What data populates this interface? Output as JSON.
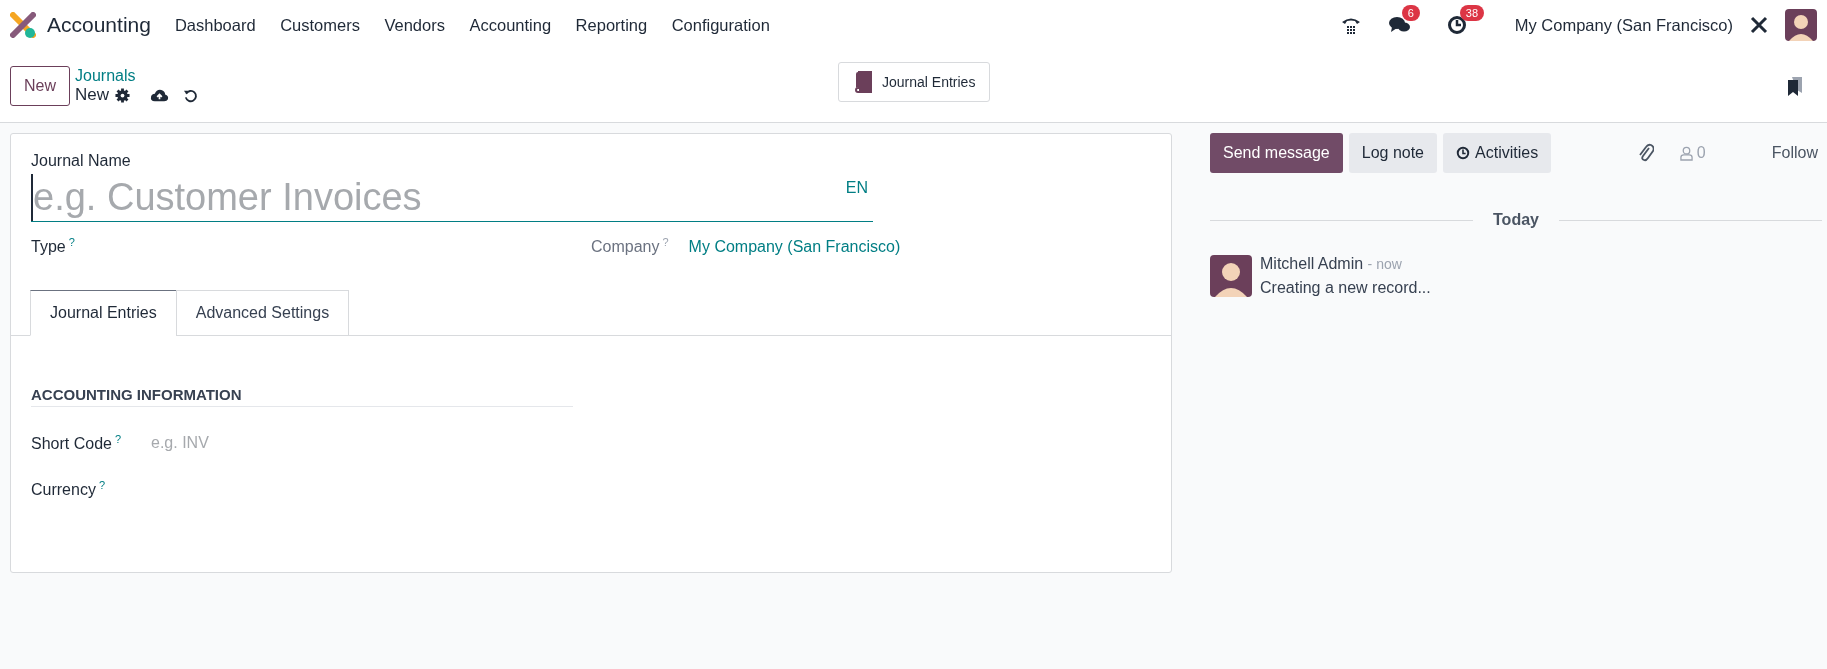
{
  "navbar": {
    "app_name": "Accounting",
    "menu": [
      "Dashboard",
      "Customers",
      "Vendors",
      "Accounting",
      "Reporting",
      "Configuration"
    ],
    "messages_count": "6",
    "activities_count": "38",
    "company": "My Company (San Francisco)"
  },
  "control_panel": {
    "new_button": "New",
    "breadcrumb": "Journals",
    "record_name": "New",
    "smart_button": "Journal Entries"
  },
  "form": {
    "journal_name": {
      "label": "Journal Name",
      "placeholder": "e.g. Customer Invoices",
      "lang": "EN"
    },
    "type": {
      "label": "Type",
      "help": "?"
    },
    "company": {
      "label": "Company",
      "help": "?",
      "value": "My Company (San Francisco)"
    },
    "tabs": [
      {
        "label": "Journal Entries",
        "selected": true
      },
      {
        "label": "Advanced Settings",
        "selected": false
      }
    ],
    "section_title": "ACCOUNTING INFORMATION",
    "fields": [
      {
        "label": "Short Code",
        "help": "?",
        "placeholder": "e.g. INV"
      },
      {
        "label": "Currency",
        "help": "?"
      }
    ]
  },
  "chatter": {
    "buttons": [
      {
        "label": "Send message",
        "kind": "primary"
      },
      {
        "label": "Log note",
        "kind": "plain"
      },
      {
        "label": "Activities",
        "kind": "clock"
      }
    ],
    "followers_count": "0",
    "follow": "Follow",
    "date_separator": "Today",
    "messages": [
      {
        "author": "Mitchell Admin",
        "time": "- now",
        "body": "Creating a new record..."
      }
    ]
  }
}
